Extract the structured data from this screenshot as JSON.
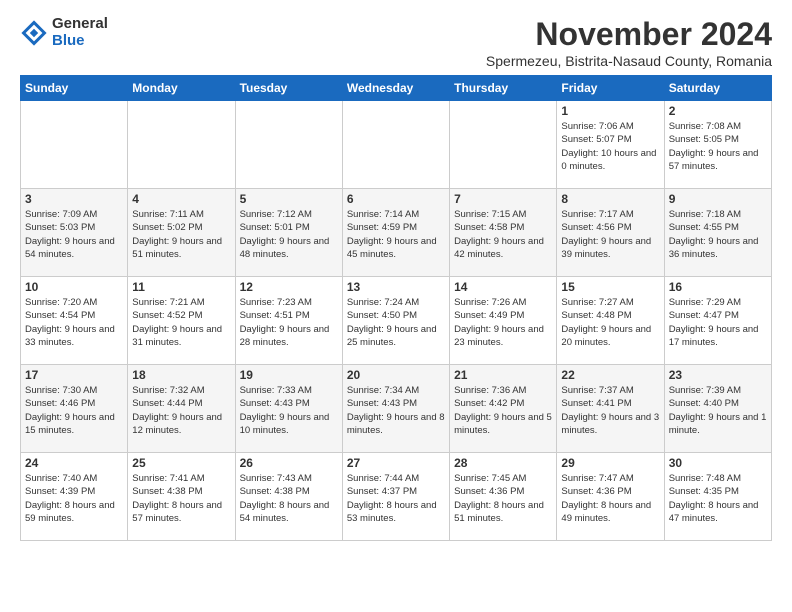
{
  "logo": {
    "general": "General",
    "blue": "Blue"
  },
  "title": "November 2024",
  "subtitle": "Spermezeu, Bistrita-Nasaud County, Romania",
  "days_of_week": [
    "Sunday",
    "Monday",
    "Tuesday",
    "Wednesday",
    "Thursday",
    "Friday",
    "Saturday"
  ],
  "weeks": [
    [
      {
        "day": "",
        "info": ""
      },
      {
        "day": "",
        "info": ""
      },
      {
        "day": "",
        "info": ""
      },
      {
        "day": "",
        "info": ""
      },
      {
        "day": "",
        "info": ""
      },
      {
        "day": "1",
        "info": "Sunrise: 7:06 AM\nSunset: 5:07 PM\nDaylight: 10 hours and 0 minutes."
      },
      {
        "day": "2",
        "info": "Sunrise: 7:08 AM\nSunset: 5:05 PM\nDaylight: 9 hours and 57 minutes."
      }
    ],
    [
      {
        "day": "3",
        "info": "Sunrise: 7:09 AM\nSunset: 5:03 PM\nDaylight: 9 hours and 54 minutes."
      },
      {
        "day": "4",
        "info": "Sunrise: 7:11 AM\nSunset: 5:02 PM\nDaylight: 9 hours and 51 minutes."
      },
      {
        "day": "5",
        "info": "Sunrise: 7:12 AM\nSunset: 5:01 PM\nDaylight: 9 hours and 48 minutes."
      },
      {
        "day": "6",
        "info": "Sunrise: 7:14 AM\nSunset: 4:59 PM\nDaylight: 9 hours and 45 minutes."
      },
      {
        "day": "7",
        "info": "Sunrise: 7:15 AM\nSunset: 4:58 PM\nDaylight: 9 hours and 42 minutes."
      },
      {
        "day": "8",
        "info": "Sunrise: 7:17 AM\nSunset: 4:56 PM\nDaylight: 9 hours and 39 minutes."
      },
      {
        "day": "9",
        "info": "Sunrise: 7:18 AM\nSunset: 4:55 PM\nDaylight: 9 hours and 36 minutes."
      }
    ],
    [
      {
        "day": "10",
        "info": "Sunrise: 7:20 AM\nSunset: 4:54 PM\nDaylight: 9 hours and 33 minutes."
      },
      {
        "day": "11",
        "info": "Sunrise: 7:21 AM\nSunset: 4:52 PM\nDaylight: 9 hours and 31 minutes."
      },
      {
        "day": "12",
        "info": "Sunrise: 7:23 AM\nSunset: 4:51 PM\nDaylight: 9 hours and 28 minutes."
      },
      {
        "day": "13",
        "info": "Sunrise: 7:24 AM\nSunset: 4:50 PM\nDaylight: 9 hours and 25 minutes."
      },
      {
        "day": "14",
        "info": "Sunrise: 7:26 AM\nSunset: 4:49 PM\nDaylight: 9 hours and 23 minutes."
      },
      {
        "day": "15",
        "info": "Sunrise: 7:27 AM\nSunset: 4:48 PM\nDaylight: 9 hours and 20 minutes."
      },
      {
        "day": "16",
        "info": "Sunrise: 7:29 AM\nSunset: 4:47 PM\nDaylight: 9 hours and 17 minutes."
      }
    ],
    [
      {
        "day": "17",
        "info": "Sunrise: 7:30 AM\nSunset: 4:46 PM\nDaylight: 9 hours and 15 minutes."
      },
      {
        "day": "18",
        "info": "Sunrise: 7:32 AM\nSunset: 4:44 PM\nDaylight: 9 hours and 12 minutes."
      },
      {
        "day": "19",
        "info": "Sunrise: 7:33 AM\nSunset: 4:43 PM\nDaylight: 9 hours and 10 minutes."
      },
      {
        "day": "20",
        "info": "Sunrise: 7:34 AM\nSunset: 4:43 PM\nDaylight: 9 hours and 8 minutes."
      },
      {
        "day": "21",
        "info": "Sunrise: 7:36 AM\nSunset: 4:42 PM\nDaylight: 9 hours and 5 minutes."
      },
      {
        "day": "22",
        "info": "Sunrise: 7:37 AM\nSunset: 4:41 PM\nDaylight: 9 hours and 3 minutes."
      },
      {
        "day": "23",
        "info": "Sunrise: 7:39 AM\nSunset: 4:40 PM\nDaylight: 9 hours and 1 minute."
      }
    ],
    [
      {
        "day": "24",
        "info": "Sunrise: 7:40 AM\nSunset: 4:39 PM\nDaylight: 8 hours and 59 minutes."
      },
      {
        "day": "25",
        "info": "Sunrise: 7:41 AM\nSunset: 4:38 PM\nDaylight: 8 hours and 57 minutes."
      },
      {
        "day": "26",
        "info": "Sunrise: 7:43 AM\nSunset: 4:38 PM\nDaylight: 8 hours and 54 minutes."
      },
      {
        "day": "27",
        "info": "Sunrise: 7:44 AM\nSunset: 4:37 PM\nDaylight: 8 hours and 53 minutes."
      },
      {
        "day": "28",
        "info": "Sunrise: 7:45 AM\nSunset: 4:36 PM\nDaylight: 8 hours and 51 minutes."
      },
      {
        "day": "29",
        "info": "Sunrise: 7:47 AM\nSunset: 4:36 PM\nDaylight: 8 hours and 49 minutes."
      },
      {
        "day": "30",
        "info": "Sunrise: 7:48 AM\nSunset: 4:35 PM\nDaylight: 8 hours and 47 minutes."
      }
    ]
  ]
}
